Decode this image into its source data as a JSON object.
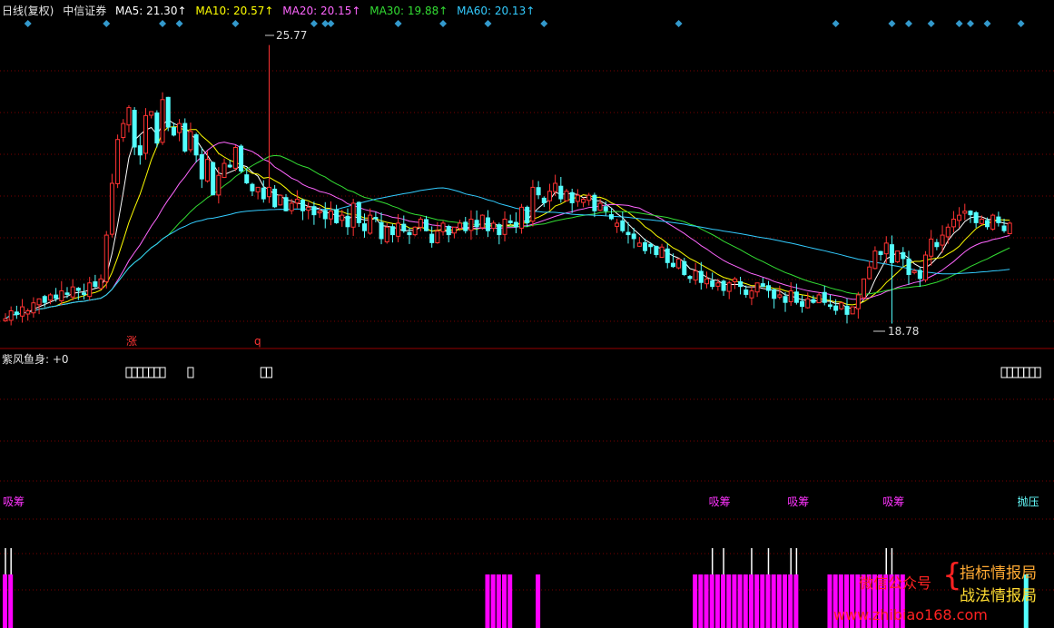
{
  "header": {
    "period": "日线(复权)",
    "stock": "中信证券",
    "ma": [
      {
        "label": "MA5: 21.30↑",
        "color": "#ffffff"
      },
      {
        "label": "MA10: 20.57↑",
        "color": "#ffff00"
      },
      {
        "label": "MA20: 20.15↑",
        "color": "#ff66ff"
      },
      {
        "label": "MA30: 19.88↑",
        "color": "#33dd33"
      },
      {
        "label": "MA60: 20.13↑",
        "color": "#33ccff"
      }
    ]
  },
  "colors": {
    "up": "#ff3333",
    "down": "#54ffff",
    "signal": "#ff00ff",
    "grid": "#7a0000",
    "sep": "#990000"
  },
  "chart_data": {
    "type": "candlestick",
    "high_label": "25.77",
    "low_label": "18.78",
    "ylim": [
      18.2,
      26.4
    ],
    "closes": [
      18.9,
      19.1,
      19.0,
      19.2,
      19.1,
      19.3,
      19.4,
      19.3,
      19.5,
      19.4,
      19.6,
      19.5,
      19.7,
      19.6,
      19.5,
      19.8,
      19.7,
      19.9,
      21.0,
      22.3,
      23.4,
      23.8,
      24.2,
      23.2,
      23.0,
      24.0,
      24.1,
      23.3,
      24.4,
      23.7,
      23.5,
      23.8,
      23.1,
      23.6,
      23.0,
      22.4,
      22.9,
      22.0,
      22.5,
      22.8,
      22.7,
      23.2,
      22.6,
      22.3,
      22.1,
      22.2,
      21.9,
      22.2,
      21.7,
      22.0,
      21.6,
      21.8,
      21.9,
      21.6,
      21.7,
      21.5,
      21.6,
      21.4,
      21.6,
      21.3,
      21.5,
      21.2,
      21.8,
      21.3,
      21.1,
      21.5,
      21.4,
      20.9,
      21.2,
      21.0,
      21.3,
      21.1,
      21.0,
      21.2,
      21.4,
      21.1,
      20.8,
      21.1,
      21.3,
      21.0,
      21.2,
      21.3,
      21.1,
      21.4,
      21.2,
      21.5,
      21.1,
      21.3,
      21.0,
      21.4,
      21.3,
      21.2,
      21.7,
      21.3,
      22.2,
      22.0,
      21.8,
      22.1,
      22.3,
      21.9,
      22.1,
      21.8,
      22.0,
      21.9,
      22.0,
      21.6,
      21.8,
      21.6,
      21.4,
      21.3,
      21.1,
      21.0,
      20.9,
      20.8,
      20.6,
      20.7,
      20.5,
      20.7,
      20.3,
      20.2,
      20.4,
      20.0,
      19.9,
      20.1,
      19.8,
      19.9,
      19.7,
      19.8,
      19.6,
      19.8,
      19.9,
      19.7,
      19.5,
      19.6,
      19.8,
      19.7,
      19.6,
      19.4,
      19.5,
      19.3,
      19.6,
      19.3,
      19.2,
      19.4,
      19.3,
      19.5,
      19.3,
      19.2,
      19.1,
      19.3,
      19.0,
      19.2,
      19.5,
      19.9,
      20.2,
      20.6,
      20.5,
      20.8,
      20.3,
      20.6,
      20.4,
      20.0,
      20.1,
      19.9,
      20.5,
      20.9,
      20.7,
      21.0,
      21.2,
      21.4,
      21.5,
      21.6,
      21.5,
      21.3,
      21.4,
      21.2,
      21.5,
      21.3,
      21.1,
      21.3
    ]
  },
  "labels": {
    "rise": "涨",
    "q": "q"
  },
  "indicator": {
    "title": "紫风鱼身: +0",
    "box_groups": [
      {
        "start": 22,
        "count": 7
      },
      {
        "start": 33,
        "count": 1
      },
      {
        "start": 46,
        "count": 2
      },
      {
        "start": 178,
        "count": 7
      }
    ],
    "signals": [
      {
        "text": "吸筹",
        "i": 0,
        "color": "#ff33ff"
      },
      {
        "text": "吸筹",
        "i": 126,
        "color": "#ff33ff"
      },
      {
        "text": "吸筹",
        "i": 140,
        "color": "#ff33ff"
      },
      {
        "text": "吸筹",
        "i": 157,
        "color": "#ff33ff"
      },
      {
        "text": "抛压",
        "i": 181,
        "color": "#66ffff"
      }
    ],
    "tall_ticks": [
      0,
      1,
      126,
      128,
      133,
      136,
      140,
      141,
      157,
      158
    ],
    "bar_ranges": [
      [
        0,
        1
      ],
      [
        86,
        90
      ],
      [
        95,
        95
      ],
      [
        123,
        141
      ],
      [
        147,
        160
      ]
    ],
    "cyan_bar": 182
  },
  "watermark": {
    "left": "微信公众号",
    "right1": "指标情报局",
    "right2": "战法情报局",
    "site": "www.zhibiao168.com"
  }
}
